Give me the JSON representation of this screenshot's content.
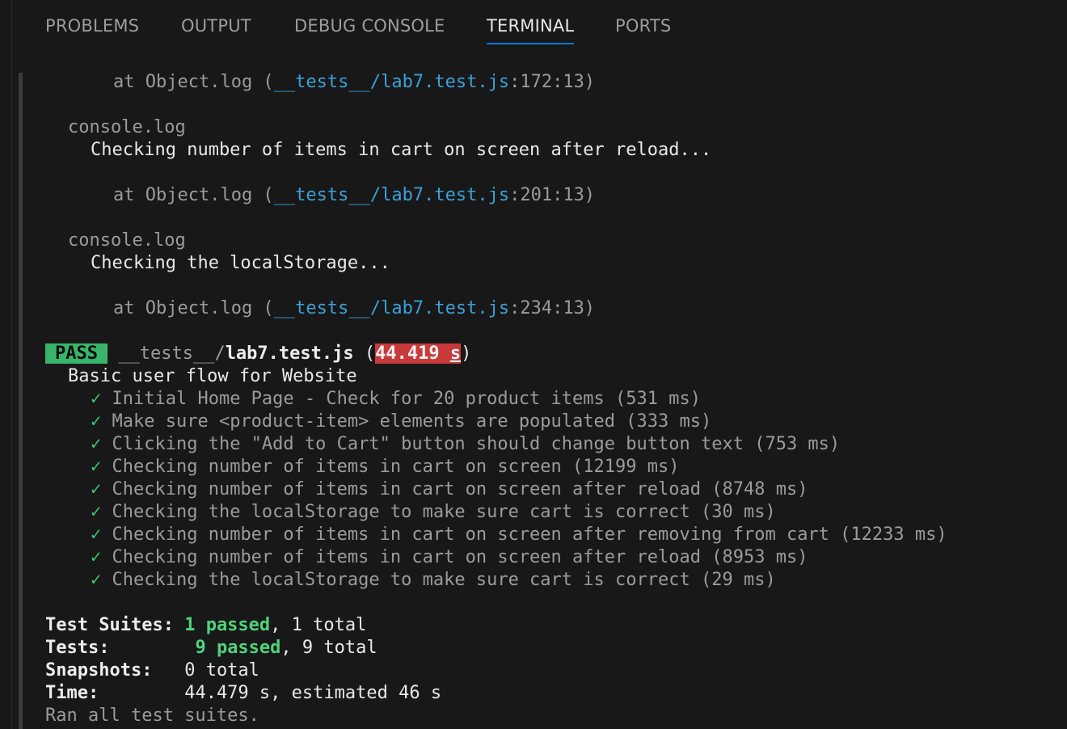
{
  "tabs": [
    {
      "label": "PROBLEMS"
    },
    {
      "label": "OUTPUT"
    },
    {
      "label": "DEBUG CONSOLE"
    },
    {
      "label": "TERMINAL"
    },
    {
      "label": "PORTS"
    }
  ],
  "active_tab": "TERMINAL",
  "colors": {
    "background": "#181818",
    "pass_badge": "#38b56a",
    "slow_time_badge": "#c83a3a",
    "link": "#3aa0d8",
    "check": "#3fc56e",
    "active_tab_underline": "#0078d4"
  },
  "log_blocks": {
    "first_at": {
      "prefix": "at Object.log (",
      "path": "__tests__/lab7.test.js",
      "location": ":172:13)"
    },
    "block2": {
      "label": "console.log",
      "message": "Checking number of items in cart on screen after reload...",
      "at": {
        "prefix": "at Object.log (",
        "path": "__tests__/lab7.test.js",
        "location": ":201:13)"
      }
    },
    "block3": {
      "label": "console.log",
      "message": "Checking the localStorage...",
      "at": {
        "prefix": "at Object.log (",
        "path": "__tests__/lab7.test.js",
        "location": ":234:13)"
      }
    }
  },
  "result": {
    "badge": "PASS",
    "dir": "__tests__/",
    "file": "lab7.test.js",
    "open_paren": " (",
    "duration_value": "44.419 ",
    "duration_unit": "s",
    "close_paren": ")",
    "suite_name": "Basic user flow for Website",
    "check_mark": "✓",
    "tests": [
      "Initial Home Page - Check for 20 product items (531 ms)",
      "Make sure <product-item> elements are populated (333 ms)",
      "Clicking the \"Add to Cart\" button should change button text (753 ms)",
      "Checking number of items in cart on screen (12199 ms)",
      "Checking number of items in cart on screen after reload (8748 ms)",
      "Checking the localStorage to make sure cart is correct (30 ms)",
      "Checking number of items in cart on screen after removing from cart (12233 ms)",
      "Checking number of items in cart on screen after reload (8953 ms)",
      "Checking the localStorage to make sure cart is correct (29 ms)"
    ]
  },
  "summary": {
    "suites_label": "Test Suites:",
    "suites_passed": "1 passed",
    "suites_total": ", 1 total",
    "tests_label": "Tests:",
    "tests_passed": "9 passed",
    "tests_total": ", 9 total",
    "snapshots_label": "Snapshots:",
    "snapshots_value": "0 total",
    "time_label": "Time:",
    "time_value": "44.479 s, estimated 46 s",
    "ran_all": "Ran all test suites."
  }
}
